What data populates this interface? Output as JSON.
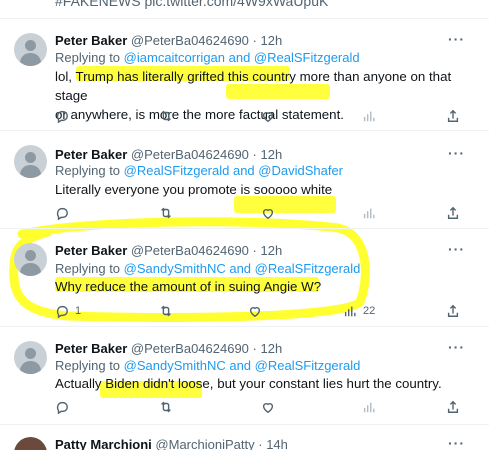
{
  "top_fragment": "#FAKENEWS pic.twitter.com/4W9xWaUpuK",
  "tweets": [
    {
      "name": "Peter Baker",
      "handle": "@PeterBa04624690",
      "separator": "·",
      "time": "12h",
      "replying_prefix": "Replying to",
      "replying_to": "@iamcaitcorrigan and @RealSFitzgerald",
      "text_line1": "lol, Trump has literally grifted this country more than anyone on that stage",
      "text_line2": "or anywhere, is more the more factual statement.",
      "more": "···"
    },
    {
      "name": "Peter Baker",
      "handle": "@PeterBa04624690",
      "separator": "·",
      "time": "12h",
      "replying_prefix": "Replying to",
      "replying_to": "@RealSFitzgerald and @DavidShafer",
      "text_line1": "Literally everyone you promote is sooooo white",
      "more": "···"
    },
    {
      "name": "Peter Baker",
      "handle": "@PeterBa04624690",
      "separator": "·",
      "time": "12h",
      "replying_prefix": "Replying to",
      "replying_to": "@SandySmithNC and @RealSFitzgerald",
      "text_line1": "Why reduce the amount of in suing Angie W?",
      "reply_count": "1",
      "views_count": "22",
      "more": "···"
    },
    {
      "name": "Peter Baker",
      "handle": "@PeterBa04624690",
      "separator": "·",
      "time": "12h",
      "replying_prefix": "Replying to",
      "replying_to": "@SandySmithNC and @RealSFitzgerald",
      "text_line1": "Actually Biden didn't loose, but your constant lies hurt the country.",
      "more": "···"
    },
    {
      "name": "Patty Marchioni",
      "handle": "@MarchioniPatty",
      "separator": "·",
      "time": "14h",
      "more": "···"
    }
  ],
  "colors": {
    "highlight": "#ffff1a",
    "link": "#1d9bf0",
    "muted": "#536471"
  }
}
